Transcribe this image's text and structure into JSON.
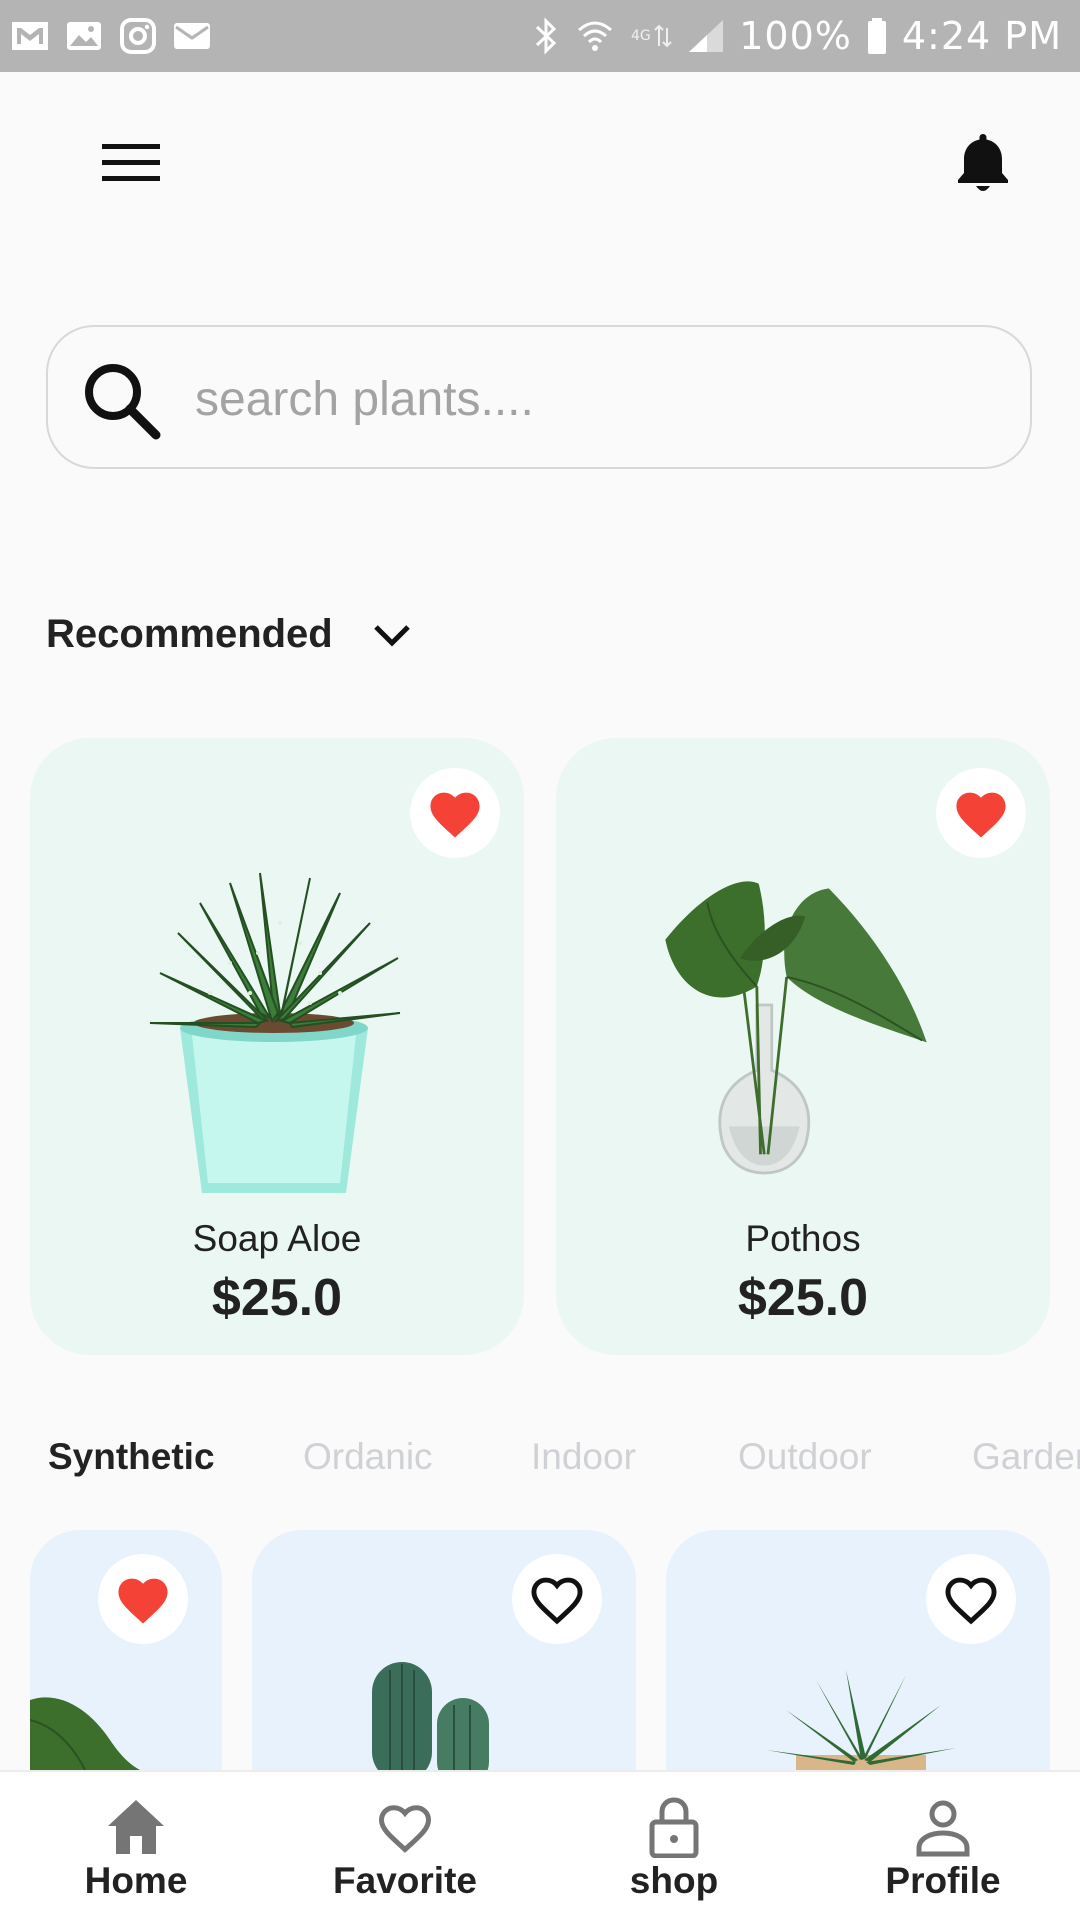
{
  "status_bar": {
    "battery": "100%",
    "time": "4:24 PM",
    "notification_icons": [
      "gmail-icon",
      "gallery-icon",
      "instagram-icon",
      "mail-icon"
    ],
    "system_icons": [
      "bluetooth-icon",
      "wifi-icon",
      "lte-icon",
      "signal-icon",
      "battery-icon"
    ]
  },
  "header": {
    "menu_icon": "menu-icon",
    "bell_icon": "bell-icon"
  },
  "search": {
    "placeholder": "search plants....",
    "value": ""
  },
  "section": {
    "title": "Recommended"
  },
  "recommended": [
    {
      "name": "Soap Aloe",
      "price": "$25.0",
      "favorite": true
    },
    {
      "name": "Pothos",
      "price": "$25.0",
      "favorite": true
    }
  ],
  "categories": [
    {
      "label": "Synthetic",
      "active": true
    },
    {
      "label": "Ordanic",
      "active": false
    },
    {
      "label": "Indoor",
      "active": false
    },
    {
      "label": "Outdoor",
      "active": false
    },
    {
      "label": "Garden",
      "active": false
    }
  ],
  "category_items": [
    {
      "favorite": true
    },
    {
      "favorite": false
    },
    {
      "favorite": false
    }
  ],
  "bottom_nav": [
    {
      "label": "Home",
      "icon": "home-icon"
    },
    {
      "label": "Favorite",
      "icon": "heart-icon"
    },
    {
      "label": "shop",
      "icon": "lock-icon"
    },
    {
      "label": "Profile",
      "icon": "person-icon"
    }
  ],
  "colors": {
    "accent_heart": "#f44336",
    "recommended_card_bg": "#ebf7f2",
    "category_card_bg": "#e8f2fc",
    "status_bar_bg": "#b4b4b4",
    "inactive_tab": "#cfd1d4"
  }
}
